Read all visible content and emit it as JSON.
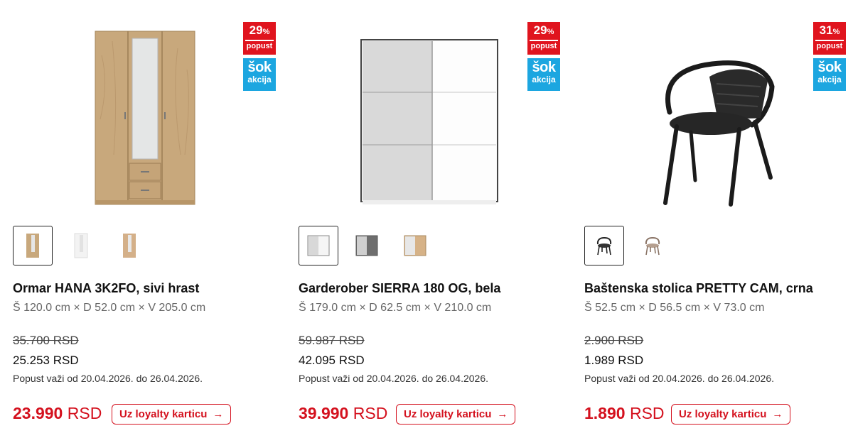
{
  "products": [
    {
      "name": "Ormar HANA 3K2FO, sivi hrast",
      "dimensions": "Š 120.0 cm × D 52.0 cm × V 205.0 cm",
      "old_price": "35.700 RSD",
      "price": "25.253 RSD",
      "validity": "Popust važi od 20.04.2026. do 26.04.2026.",
      "loyalty_amount": "23.990",
      "loyalty_currency": "RSD",
      "loyalty_button": "Uz loyalty karticu",
      "badge_percent": "29",
      "badge_percent_sign": "%",
      "badge_label": "popust",
      "sok_line1": "šok",
      "sok_line2": "akcija",
      "image_icon": "wardrobe-icon",
      "thumbnails": [
        "wardrobe-oak-icon",
        "wardrobe-white-icon",
        "wardrobe-light-oak-icon"
      ]
    },
    {
      "name": "Garderober SIERRA 180 OG, bela",
      "dimensions": "Š 179.0 cm × D 62.5 cm × V 210.0 cm",
      "old_price": "59.987 RSD",
      "price": "42.095 RSD",
      "validity": "Popust važi od 20.04.2026. do 26.04.2026.",
      "loyalty_amount": "39.990",
      "loyalty_currency": "RSD",
      "loyalty_button": "Uz loyalty karticu",
      "badge_percent": "29",
      "badge_percent_sign": "%",
      "badge_label": "popust",
      "sok_line1": "šok",
      "sok_line2": "akcija",
      "image_icon": "sliding-wardrobe-icon",
      "thumbnails": [
        "wardrobe-white-icon",
        "wardrobe-grey-icon",
        "wardrobe-oak-white-icon"
      ]
    },
    {
      "name": "Baštenska stolica PRETTY CAM, crna",
      "dimensions": "Š 52.5 cm × D 56.5 cm × V 73.0 cm",
      "old_price": "2.900 RSD",
      "price": "1.989 RSD",
      "validity": "Popust važi od 20.04.2026. do 26.04.2026.",
      "loyalty_amount": "1.890",
      "loyalty_currency": "RSD",
      "loyalty_button": "Uz loyalty karticu",
      "badge_percent": "31",
      "badge_percent_sign": "%",
      "badge_label": "popust",
      "sok_line1": "šok",
      "sok_line2": "akcija",
      "image_icon": "garden-chair-icon",
      "thumbnails": [
        "chair-black-icon",
        "chair-beige-icon"
      ]
    }
  ],
  "colors": {
    "accent_red": "#d4111e",
    "badge_red": "#e0141e",
    "badge_blue": "#1ca6e0"
  }
}
